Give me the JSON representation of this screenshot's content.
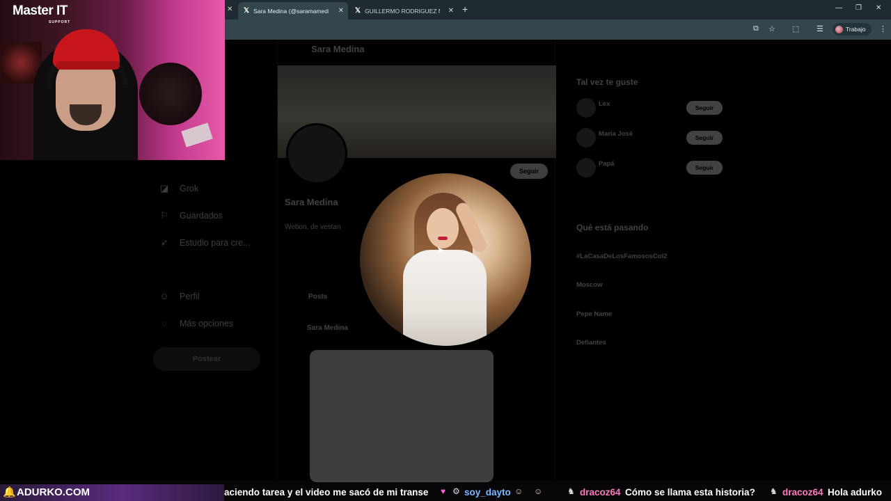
{
  "browser": {
    "tabs": [
      {
        "label": "Sara Medina (@saramamedina",
        "active": true
      },
      {
        "label": "GUILLERMO RODRIGUEZ M (@",
        "active": false
      }
    ],
    "profile_chip": "Trabajo"
  },
  "overlay": {
    "logo_main": "Master IT",
    "logo_sub": "SUPPORT"
  },
  "page": {
    "header_name": "Sara Medina",
    "profile_name": "Sara Medina",
    "bio": "Webon, de vestan",
    "posts_tab": "Posts",
    "tweet_author": "Sara Medina",
    "nav": [
      {
        "label": "Grok",
        "icon": "grok-icon"
      },
      {
        "label": "Guardados",
        "icon": "bookmark-icon"
      },
      {
        "label": "Estudio para cre...",
        "icon": "rocket-icon"
      },
      {
        "label": "Perfil",
        "icon": "person-icon"
      },
      {
        "label": "Más opciones",
        "icon": "more-circle-icon"
      }
    ],
    "post_button": "Postear",
    "follow_button": "Seguir",
    "sidebar": {
      "who_title": "Tal vez te guste",
      "who": [
        {
          "name": "Lex",
          "button": "Seguir"
        },
        {
          "name": "Maria José",
          "button": "Seguir"
        },
        {
          "name": "Papá",
          "button": "Seguir"
        }
      ],
      "trends_title": "Qué está pasando",
      "trends": [
        "#LaCasaDeLosFamososCol2",
        "Moscow",
        "Pepe Name",
        "Defiantes"
      ]
    }
  },
  "ticker": {
    "brand": "ADURKO.COM",
    "messages": [
      {
        "user": "",
        "text": "aciendo tarea y el video me sacó de mi transe"
      },
      {
        "user": "soy_dayto",
        "text": ""
      },
      {
        "user": "dracoz64",
        "text": "Cómo se llama esta historia?"
      },
      {
        "user": "dracoz64",
        "text": "Hola adurko"
      }
    ]
  }
}
